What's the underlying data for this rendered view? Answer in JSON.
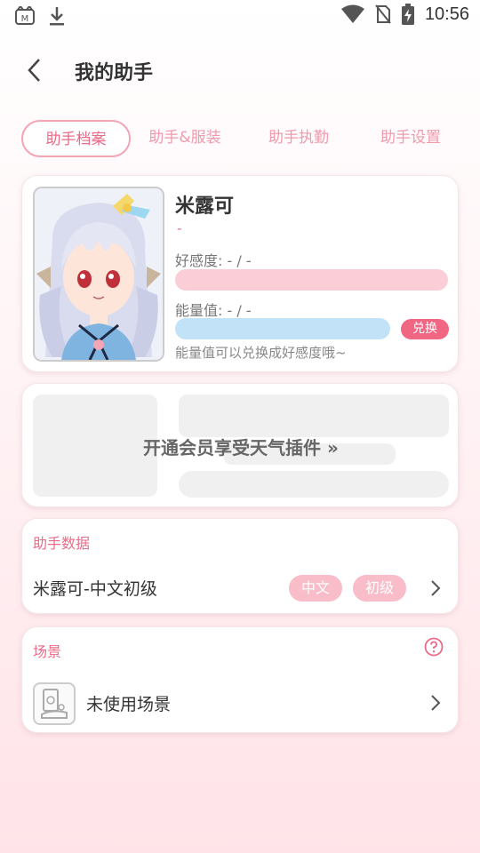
{
  "status_bar": {
    "time": "10:56"
  },
  "header": {
    "title": "我的助手"
  },
  "tabs": [
    {
      "label": "助手档案"
    },
    {
      "label": "助手&服装"
    },
    {
      "label": "助手执勤"
    },
    {
      "label": "助手设置"
    }
  ],
  "profile": {
    "name": "米露可",
    "subtitle": "-",
    "favor_label": "好感度: - / -",
    "energy_label": "能量值: - / -",
    "exchange_label": "兑换",
    "hint": "能量值可以兑换成好感度哦~"
  },
  "weather": {
    "cta": "开通会员享受天气插件 »"
  },
  "assistant_data": {
    "title": "助手数据",
    "row_text": "米露可-中文初级",
    "tags": [
      "中文",
      "初级"
    ]
  },
  "scene": {
    "title": "场景",
    "row_text": "未使用场景"
  },
  "colors": {
    "accent": "#e96b87",
    "favor_bar": "#fbcdd6",
    "energy_bar": "#c2e3f7",
    "tag_bg": "#f9bdc9"
  }
}
